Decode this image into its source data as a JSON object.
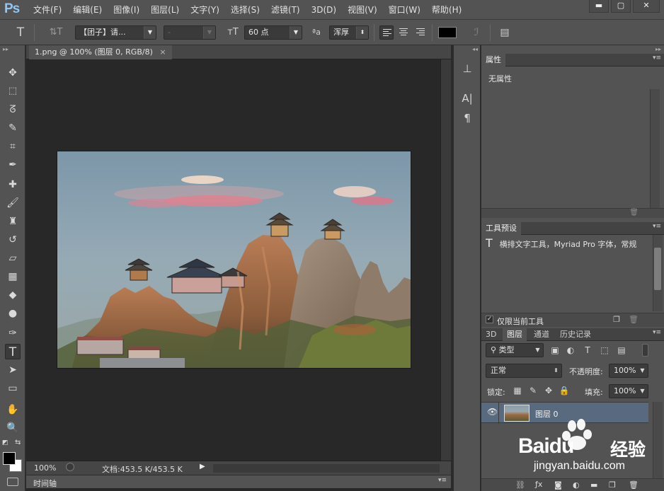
{
  "app": {
    "logo": "Ps"
  },
  "menu": [
    "文件(F)",
    "编辑(E)",
    "图像(I)",
    "图层(L)",
    "文字(Y)",
    "选择(S)",
    "滤镜(T)",
    "3D(D)",
    "视图(V)",
    "窗口(W)",
    "帮助(H)"
  ],
  "window_controls": {
    "minimize": "▬",
    "maximize": "▢",
    "close": "✕"
  },
  "options": {
    "font_family": "【团子】请...",
    "font_style": "-",
    "font_size": "60 点",
    "aa_label": "ªa",
    "antialias": "浑厚",
    "text_color": "#000000"
  },
  "document": {
    "tab_label": "1.png @ 100% (图层 0, RGB/8)",
    "tab_close": "×",
    "zoom": "100%",
    "doc_info": "文档:453.5 K/453.5 K",
    "timeline_label": "时间轴"
  },
  "panels": {
    "properties": {
      "title": "属性",
      "content": "无属性"
    },
    "tool_presets": {
      "title": "工具预设",
      "item": "横排文字工具，Myriad Pro 字体，常规",
      "only_current": "仅限当前工具"
    },
    "layers": {
      "tabs": [
        "3D",
        "图层",
        "通道",
        "历史记录"
      ],
      "active_tab": "图层",
      "filter": "类型",
      "blend_mode": "正常",
      "opacity_label": "不透明度:",
      "opacity": "100%",
      "lock_label": "锁定:",
      "fill_label": "填充:",
      "fill": "100%",
      "layer_name": "图层 0"
    }
  },
  "colors": {
    "foreground": "#000000",
    "background": "#ffffff",
    "selected_layer": "#596a7e",
    "ps_logo": "#8ec6f5"
  },
  "watermark": {
    "brand": "Baidu",
    "brand_cn": "经验",
    "url": "jingyan.baidu.com"
  }
}
